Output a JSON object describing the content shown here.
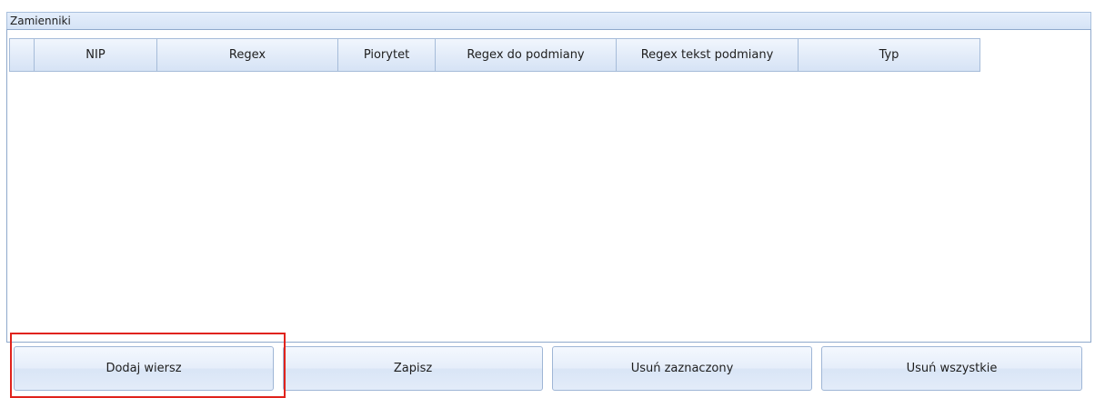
{
  "group": {
    "title": "Zamienniki"
  },
  "grid": {
    "columns": [
      "",
      "NIP",
      "Regex",
      "Piorytet",
      "Regex do podmiany",
      "Regex tekst podmiany",
      "Typ"
    ]
  },
  "buttons": {
    "add_row": "Dodaj wiersz",
    "save": "Zapisz",
    "delete_selected": "Usuń zaznaczony",
    "delete_all": "Usuń wszystkie"
  }
}
